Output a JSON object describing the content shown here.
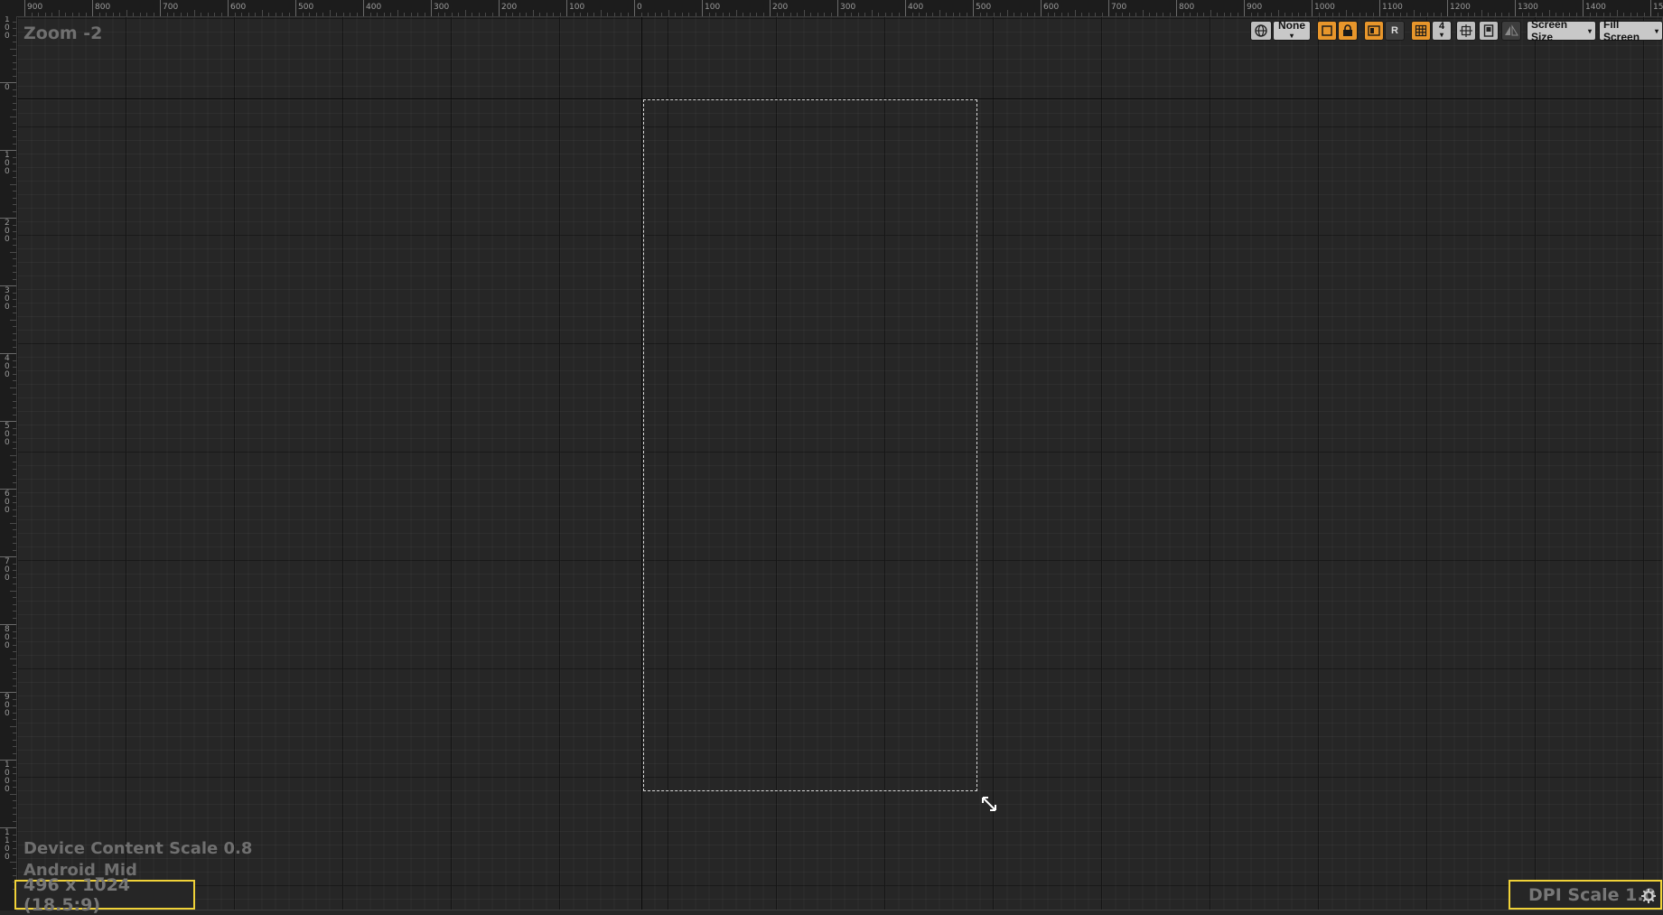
{
  "viewport": {
    "zoom_label": "Zoom -2",
    "device_content_scale": "Device Content Scale 0.8",
    "device_name": "Android_Mid",
    "resolution": "496 x 1024 (18.5:9)",
    "dpi_scale": "DPI Scale 1.0"
  },
  "rulers": {
    "horizontal_labels": [
      "900",
      "800",
      "700",
      "600",
      "500",
      "400",
      "300",
      "200",
      "100",
      "0",
      "100",
      "200",
      "300",
      "400",
      "500",
      "600",
      "700",
      "800",
      "900",
      "1000",
      "1100",
      "1200",
      "1300",
      "1400",
      "15"
    ],
    "vertical_labels": [
      "100",
      "0",
      "100",
      "200",
      "300",
      "400",
      "500",
      "600",
      "700",
      "800",
      "900",
      "1000",
      "1100"
    ]
  },
  "toolbar": {
    "world_icon": "globe-icon",
    "localization_dropdown": "None",
    "outline_icon": "outline-icon",
    "lock_icon": "lock-icon",
    "respect_locks_icon": "layout-icon",
    "r_label": "R",
    "grid_icon": "grid-icon",
    "grid_snap_value": "4",
    "transform_icon": "transform-icon",
    "bookmark_icon": "bookmark-icon",
    "mirror_icon": "mirror-icon",
    "screen_size_label": "Screen Size",
    "fill_screen_label": "Fill Screen"
  },
  "colors": {
    "accent": "#e8962b",
    "highlight": "#f0d238",
    "canvas": "#262626"
  }
}
